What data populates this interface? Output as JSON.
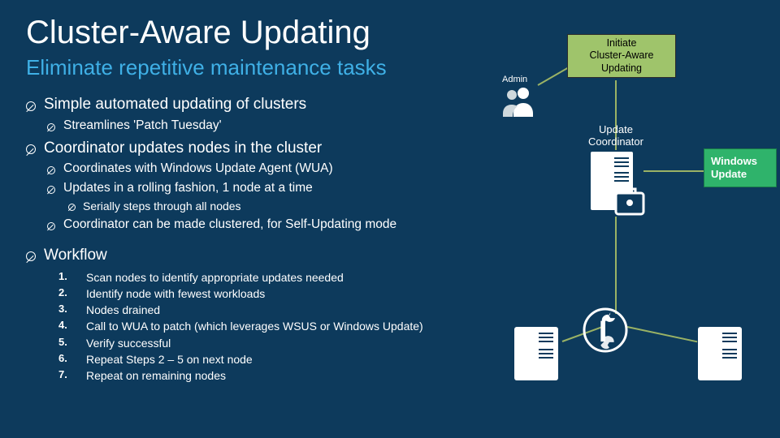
{
  "title": "Cluster-Aware Updating",
  "subtitle": "Eliminate repetitive maintenance tasks",
  "bullets": {
    "b1": "Simple automated updating of clusters",
    "b1a": "Streamlines 'Patch Tuesday'",
    "b2": "Coordinator updates nodes in the cluster",
    "b2a": "Coordinates with Windows Update Agent (WUA)",
    "b2b": "Updates in a rolling fashion, 1 node at a time",
    "b2b1": "Serially steps through all nodes",
    "b2c": "Coordinator can be made clustered, for Self-Updating mode",
    "b3": "Workflow"
  },
  "workflow": [
    "Scan nodes to identify appropriate updates needed",
    "Identify node with fewest workloads",
    "Nodes drained",
    "Call to WUA to patch (which leverages WSUS or Windows Update)",
    "Verify successful",
    "Repeat Steps 2 – 5 on next node",
    "Repeat on remaining nodes"
  ],
  "diagram": {
    "admin_label": "Admin",
    "initiate_line1": "Initiate",
    "initiate_line2": "Cluster-Aware",
    "initiate_line3": "Updating",
    "update_coord": "Update Coordinator",
    "windows_update": "Windows Update"
  },
  "colors": {
    "bg": "#0d3a5c",
    "accent": "#3fb0e6",
    "green_box": "#9fc46b",
    "wu_green": "#2fb36b",
    "line": "#9ab265"
  }
}
